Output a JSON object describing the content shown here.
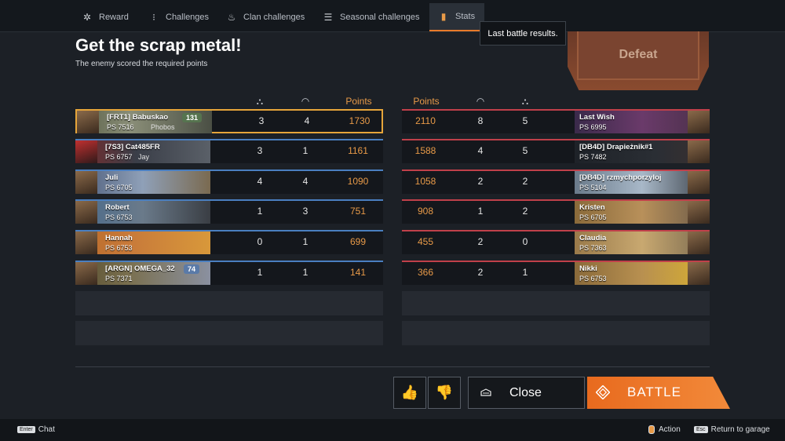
{
  "tabs": [
    {
      "label": "Reward",
      "icon": "gear-icon"
    },
    {
      "label": "Challenges",
      "icon": "exclamation-icon"
    },
    {
      "label": "Clan challenges",
      "icon": "flame-icon"
    },
    {
      "label": "Seasonal challenges",
      "icon": "hand-icon"
    },
    {
      "label": "Stats",
      "icon": "stats-icon"
    }
  ],
  "tooltip": "Last battle results.",
  "result_banner": "Defeat",
  "title": "Get the scrap metal!",
  "subtitle": "The enemy scored the required points",
  "headers": {
    "kills": "⛬",
    "assists": "◠",
    "points": "Points"
  },
  "left_team": [
    {
      "name": "[FRT1] Babuskao",
      "ps": "PS 7516",
      "extra": "Phobos",
      "badge": "131",
      "kills": "3",
      "assists": "4",
      "points": "1730"
    },
    {
      "name": "[7S3] Cat485FR",
      "ps": "PS 6757",
      "extra": "Jay",
      "badge": "",
      "kills": "3",
      "assists": "1",
      "points": "1161"
    },
    {
      "name": "Juli",
      "ps": "PS 6705",
      "extra": "",
      "badge": "",
      "kills": "4",
      "assists": "4",
      "points": "1090"
    },
    {
      "name": "Robert",
      "ps": "PS 6753",
      "extra": "",
      "badge": "",
      "kills": "1",
      "assists": "3",
      "points": "751"
    },
    {
      "name": "Hannah",
      "ps": "PS 6753",
      "extra": "",
      "badge": "",
      "kills": "0",
      "assists": "1",
      "points": "699"
    },
    {
      "name": "[ARGN] OMEGA_32",
      "ps": "PS 7371",
      "extra": "",
      "badge": "74",
      "kills": "1",
      "assists": "1",
      "points": "141"
    }
  ],
  "right_team": [
    {
      "name": "Last Wish",
      "ps": "PS 6995",
      "points": "2110",
      "assists": "8",
      "kills": "5"
    },
    {
      "name": "[DB4D] Drapieżnik#1",
      "ps": "PS 7482",
      "points": "1588",
      "assists": "4",
      "kills": "5"
    },
    {
      "name": "[DB4D] rzmychporzyloj",
      "ps": "PS 5104",
      "points": "1058",
      "assists": "2",
      "kills": "2"
    },
    {
      "name": "Kristen",
      "ps": "PS 6705",
      "points": "908",
      "assists": "1",
      "kills": "2"
    },
    {
      "name": "Claudia",
      "ps": "PS 7363",
      "points": "455",
      "assists": "2",
      "kills": "0"
    },
    {
      "name": "Nikki",
      "ps": "PS 6753",
      "points": "366",
      "assists": "2",
      "kills": "1"
    }
  ],
  "buttons": {
    "like": "👍",
    "dislike": "👎",
    "close": "Close",
    "battle": "BATTLE"
  },
  "footer": {
    "chat_key": "Enter",
    "chat": "Chat",
    "action": "Action",
    "return_key": "Esc",
    "return": "Return to garage"
  }
}
